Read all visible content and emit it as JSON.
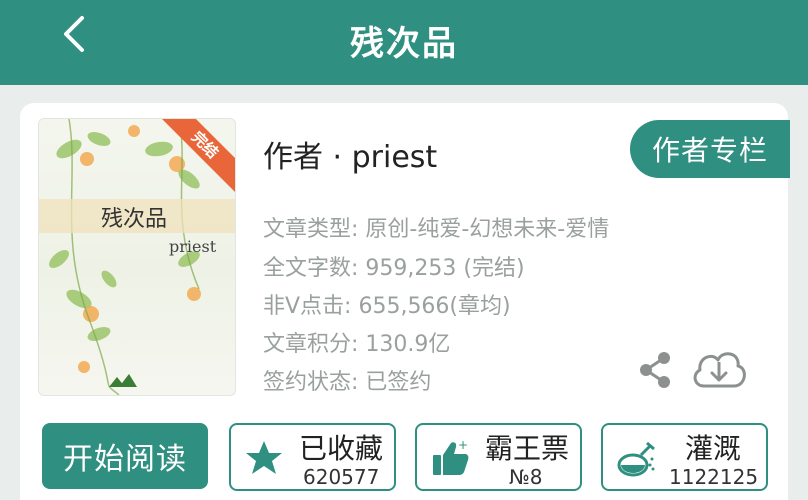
{
  "header": {
    "title": "残次品"
  },
  "cover": {
    "title": "残次品",
    "author": "priest",
    "status_ribbon": "完结"
  },
  "book": {
    "author_line": "作者 · priest",
    "author_column_label": "作者专栏",
    "info": [
      "文章类型: 原创-纯爱-幻想未来-爱情",
      "全文字数: 959,253 (完结)",
      "非V点击: 655,566(章均)",
      "文章积分: 130.9亿",
      "签约状态: 已签约"
    ]
  },
  "actions": {
    "start_reading": "开始阅读",
    "collect": {
      "label": "已收藏",
      "count": "620577"
    },
    "overlord": {
      "label": "霸王票",
      "count": "№8"
    },
    "irrigate": {
      "label": "灌溉",
      "count": "1122125"
    }
  },
  "colors": {
    "primary": "#2f8f80",
    "ribbon": "#e8663a",
    "info_text": "#9aa09d"
  },
  "icons": [
    "back-icon",
    "share-icon",
    "download-icon",
    "star-icon",
    "thumbs-up-icon",
    "flask-icon"
  ]
}
